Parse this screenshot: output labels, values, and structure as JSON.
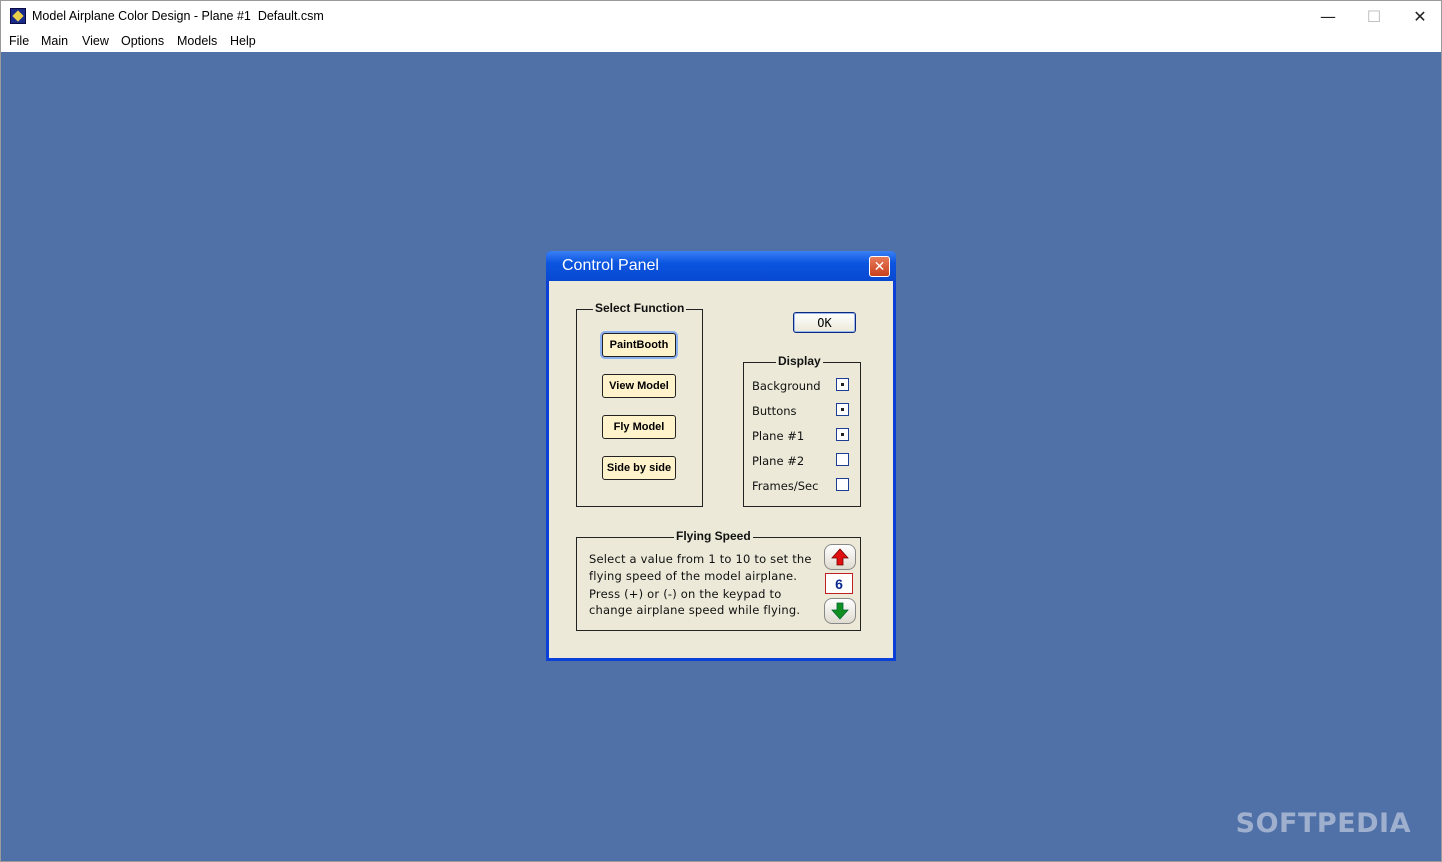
{
  "window": {
    "title": "Model Airplane Color Design - Plane #1  Default.csm",
    "controls": {
      "minimize": "—",
      "maximize": "☐",
      "close": "✕"
    }
  },
  "menu": [
    "File",
    "Main",
    "View",
    "Options",
    "Models",
    "Help"
  ],
  "watermark": "SOFTPEDIA",
  "dialog": {
    "title": "Control Panel",
    "ok_label": "OK",
    "select_function": {
      "legend": "Select Function",
      "buttons": [
        "PaintBooth",
        "View Model",
        "Fly Model",
        "Side by side"
      ]
    },
    "display": {
      "legend": "Display",
      "items": [
        {
          "label": "Background",
          "checked": true
        },
        {
          "label": "Buttons",
          "checked": true
        },
        {
          "label": "Plane #1",
          "checked": true
        },
        {
          "label": "Plane #2",
          "checked": false
        },
        {
          "label": "Frames/Sec",
          "checked": false
        }
      ]
    },
    "flying_speed": {
      "legend": "Flying Speed",
      "lines": [
        "Select a value from 1 to 10 to set the",
        "flying speed of the model airplane.",
        "Press (+) or (-) on the keypad to",
        "change airplane speed while flying."
      ],
      "value": "6"
    }
  },
  "colors": {
    "desktop": "#5070a8",
    "dialog_title": "#0b55e0",
    "dialog_body": "#ece9d8",
    "function_button": "#fff3cc",
    "up_arrow": "#e01010",
    "down_arrow": "#109020"
  }
}
